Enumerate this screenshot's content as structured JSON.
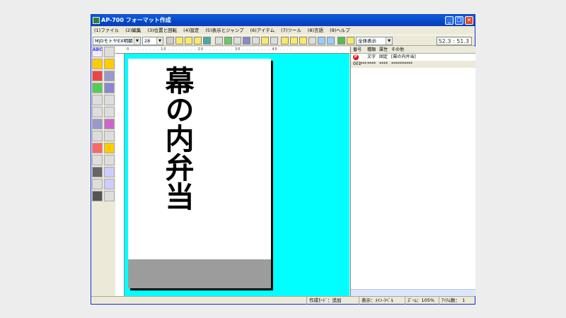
{
  "window": {
    "title": "AP-700 フォーマット作成",
    "minimize": "_",
    "restore": "❐",
    "close": "✕"
  },
  "menu": [
    "(1)ファイル",
    "(2)編集",
    "(3)位置と回転",
    "(4)設定",
    "(5)表示とジャンプ",
    "(6)アイテム",
    "(7)ツール",
    "(8)言語",
    "(9)ヘルプ"
  ],
  "toolbar": {
    "font": "MJDモトヤEX明朝",
    "size": "28",
    "view": "全体表示",
    "coordinates": "52.3 : 51.3"
  },
  "ruler": {
    "unit": "mm",
    "labels": "0 . . . . . . . . 10 . . . . . . . . 20 . . . . . . . . 30 . . . . . . . . 40 . . . ."
  },
  "canvas": {
    "text": "幕の内弁当",
    "bg_color": "#00ffff"
  },
  "list": {
    "headers": [
      "番号",
      "種類",
      "属性",
      "その他"
    ],
    "rows": [
      {
        "badge": "P",
        "no": "001",
        "type": "文字",
        "attr": "固定",
        "other": "[幕の内弁当]"
      },
      {
        "badge": "",
        "no": "***",
        "type": "****",
        "attr": "****",
        "other": "**********"
      }
    ]
  },
  "status": {
    "mode": "作成ﾓｰﾄﾞ：追加",
    "view": "表示：ﾒｲﾝ-ﾗﾍﾞﾙ",
    "zoom": "ｽﾞｰﾑ：105%",
    "items": "ｱｲﾃﾑ数：　1"
  }
}
